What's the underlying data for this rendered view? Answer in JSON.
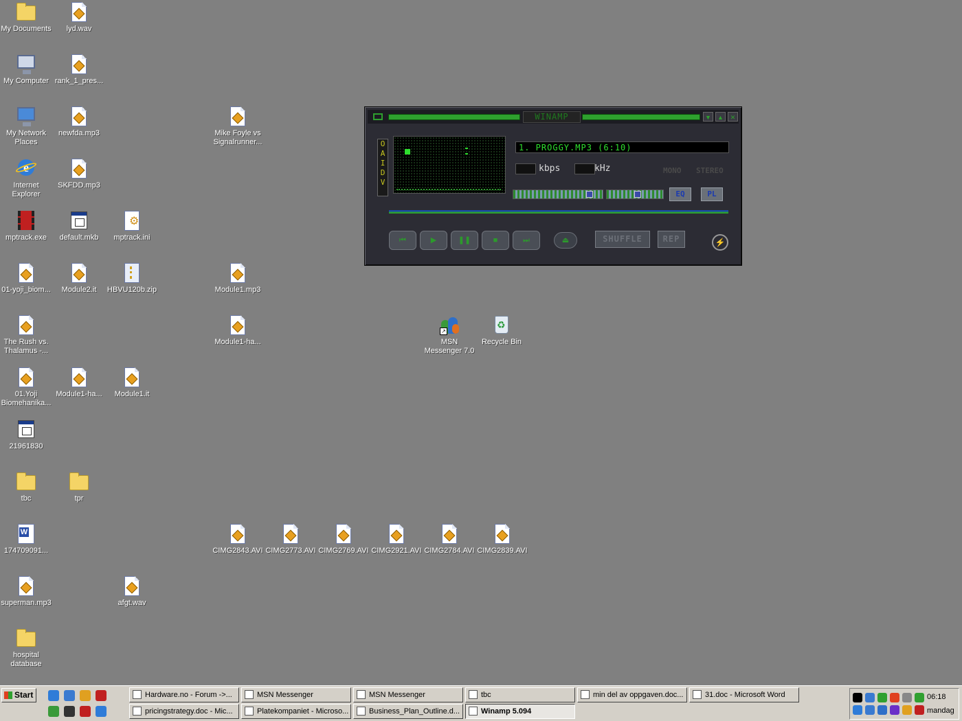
{
  "desktop": {
    "icons": [
      {
        "label": "My Documents",
        "kind": "folder-docs"
      },
      {
        "label": "lyd.wav",
        "kind": "media"
      },
      {
        "label": "My Computer",
        "kind": "computer"
      },
      {
        "label": "rank_1_pres...",
        "kind": "media"
      },
      {
        "label": "My Network Places",
        "kind": "network"
      },
      {
        "label": "newfda.mp3",
        "kind": "media"
      },
      {
        "label": "Mike Foyle vs Signalrunner...",
        "kind": "media"
      },
      {
        "label": "Internet Explorer",
        "kind": "ie"
      },
      {
        "label": "SKFDD.mp3",
        "kind": "media"
      },
      {
        "label": "mptrack.exe",
        "kind": "film"
      },
      {
        "label": "default.mkb",
        "kind": "exe"
      },
      {
        "label": "mptrack.ini",
        "kind": "ini"
      },
      {
        "label": "01-yoji_biom...",
        "kind": "media"
      },
      {
        "label": "Module2.it",
        "kind": "media"
      },
      {
        "label": "HBVU120b.zip",
        "kind": "zip"
      },
      {
        "label": "Module1.mp3",
        "kind": "media"
      },
      {
        "label": "The Rush vs. Thalamus -...",
        "kind": "media"
      },
      {
        "label": "Module1-ha...",
        "kind": "media"
      },
      {
        "label": "MSN Messenger 7.0",
        "kind": "msn"
      },
      {
        "label": "Recycle Bin",
        "kind": "bin"
      },
      {
        "label": "01.Yoji Biomehanika...",
        "kind": "media"
      },
      {
        "label": "Module1-ha...",
        "kind": "media"
      },
      {
        "label": "Module1.it",
        "kind": "media"
      },
      {
        "label": "21961830",
        "kind": "exe"
      },
      {
        "label": "tbc",
        "kind": "folder"
      },
      {
        "label": "tpr",
        "kind": "folder"
      },
      {
        "label": "174709091...",
        "kind": "word"
      },
      {
        "label": "CIMG2843.AVI",
        "kind": "media"
      },
      {
        "label": "CIMG2773.AVI",
        "kind": "media"
      },
      {
        "label": "CIMG2769.AVI",
        "kind": "media"
      },
      {
        "label": "CIMG2921.AVI",
        "kind": "media"
      },
      {
        "label": "CIMG2784.AVI",
        "kind": "media"
      },
      {
        "label": "CIMG2839.AVI",
        "kind": "media"
      },
      {
        "label": "superman.mp3",
        "kind": "media"
      },
      {
        "label": "afgt.wav",
        "kind": "media"
      },
      {
        "label": "hospital database",
        "kind": "folder"
      }
    ]
  },
  "winamp": {
    "title": "WINAMP",
    "sidebar_letters": "OAIDV",
    "song": "1. PROGGY.MP3 (6:10)",
    "kbps_label": "kbps",
    "khz_label": "kHz",
    "mono_label": "MONO",
    "stereo_label": "STEREO",
    "eq_label": "EQ",
    "pl_label": "PL",
    "shuffle_label": "SHUFFLE",
    "repeat_label": "REP",
    "volume_level": 0.88,
    "balance_level": 0.5,
    "colors": {
      "accent": "#2ea02e",
      "body": "#2c2c34"
    }
  },
  "taskbar": {
    "start_label": "Start",
    "quick_launch": [
      "ie-icon",
      "outlook-icon",
      "winamp-icon",
      "film-icon",
      "msn-icon",
      "font-icon",
      "pdf-icon",
      "search-icon"
    ],
    "tasks": [
      {
        "label": "Hardware.no - Forum ->...",
        "icon": "ie-icon"
      },
      {
        "label": "MSN Messenger",
        "icon": "msn-icon"
      },
      {
        "label": "MSN Messenger",
        "icon": "msn-icon"
      },
      {
        "label": "tbc",
        "icon": "folder-icon"
      },
      {
        "label": "min del av oppgaven.doc...",
        "icon": "word-icon"
      },
      {
        "label": "31.doc - Microsoft Word",
        "icon": "word-icon"
      },
      {
        "label": "pricingstrategy.doc - Mic...",
        "icon": "word-icon"
      },
      {
        "label": "Platekompaniet - Microso...",
        "icon": "ie-icon"
      },
      {
        "label": "Business_Plan_Outline.d...",
        "icon": "word-icon"
      },
      {
        "label": "Winamp 5.094",
        "icon": "winamp-icon",
        "active": true
      }
    ],
    "clock": "06:18",
    "day": "mandag"
  }
}
